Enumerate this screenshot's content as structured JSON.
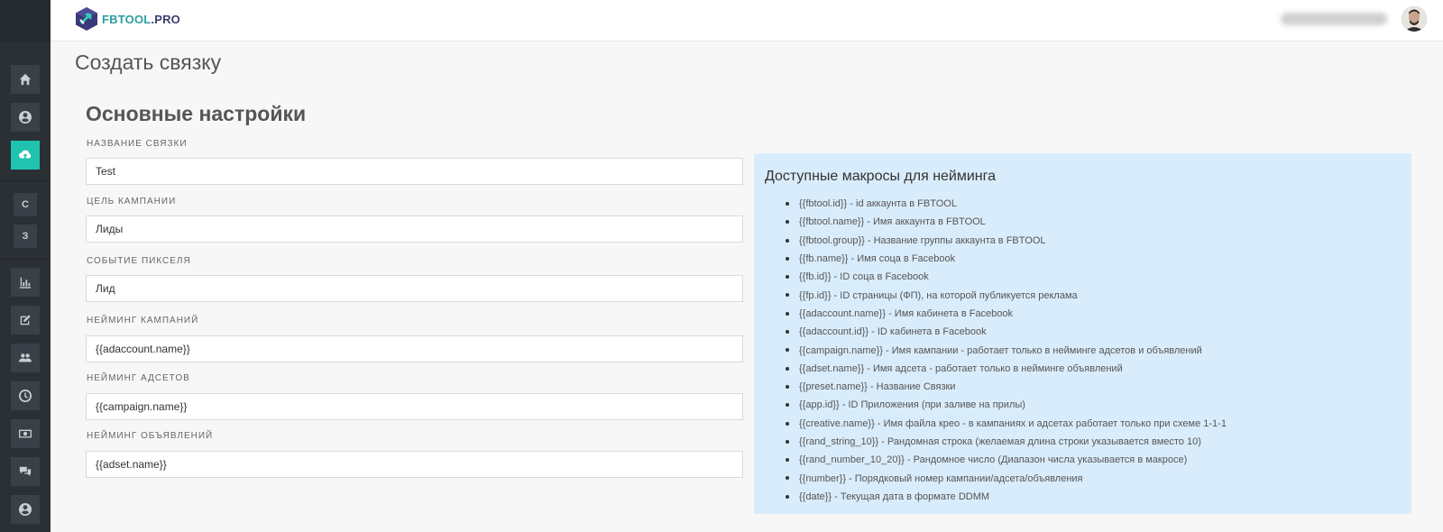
{
  "header": {
    "logo_part1": "FBTOOL",
    "logo_part2": ".PRO"
  },
  "page": {
    "title": "Создать связку",
    "section_title": "Основные настройки"
  },
  "sidebar": {
    "items": [
      {
        "icon": "home-icon"
      },
      {
        "icon": "user-circle-icon"
      },
      {
        "icon": "cloud-upload-icon",
        "active": true
      },
      {
        "letter": "С"
      },
      {
        "letter": "З"
      },
      {
        "icon": "bar-chart-icon"
      },
      {
        "icon": "edit-icon"
      },
      {
        "icon": "users-icon"
      },
      {
        "icon": "clock-icon"
      },
      {
        "icon": "money-icon"
      },
      {
        "icon": "comments-icon"
      },
      {
        "icon": "user-circle-icon"
      }
    ]
  },
  "form": {
    "fields": [
      {
        "label": "НАЗВАНИЕ СВЯЗКИ",
        "value": "Test"
      },
      {
        "label": "ЦЕЛЬ КАМПАНИИ",
        "value": "Лиды"
      },
      {
        "label": "СОБЫТИЕ ПИКСЕЛЯ",
        "value": "Лид"
      },
      {
        "label": "НЕЙМИНГ КАМПАНИЙ",
        "value": "{{adaccount.name}}"
      },
      {
        "label": "НЕЙМИНГ АДСЕТОВ",
        "value": "{{campaign.name}}"
      },
      {
        "label": "НЕЙМИНГ ОБЪЯВЛЕНИЙ",
        "value": "{{adset.name}}"
      }
    ]
  },
  "macros": {
    "title": "Доступные макросы для нейминга",
    "items": [
      {
        "code": "{{fbtool.id}}",
        "desc": " - id аккаунта в FBTOOL"
      },
      {
        "code": "{{fbtool.name}}",
        "desc": " - Имя аккаунта в FBTOOL"
      },
      {
        "code": "{{fbtool.group}}",
        "desc": " - Название группы аккаунта в FBTOOL"
      },
      {
        "code": "{{fb.name}}",
        "desc": " - Имя соца в Facebook"
      },
      {
        "code": "{{fb.id}}",
        "desc": " - ID соца в Facebook"
      },
      {
        "code": "{{fp.id}}",
        "desc": " - ID страницы (ФП), на которой публикуется реклама"
      },
      {
        "code": "{{adaccount.name}}",
        "desc": " - Имя кабинета в Facebook"
      },
      {
        "code": "{{adaccount.id}}",
        "desc": " - ID кабинета в Facebook"
      },
      {
        "code": "{{campaign.name}}",
        "desc": " - Имя кампании - работает только в нейминге адсетов и объявлений"
      },
      {
        "code": "{{adset.name}}",
        "desc": " - Имя адсета - работает только в нейминге объявлений"
      },
      {
        "code": "{{preset.name}}",
        "desc": " - Название Связки"
      },
      {
        "code": "{{app.id}}",
        "desc": " - ID Приложения (при заливе на прилы)"
      },
      {
        "code": "{{creative.name}}",
        "desc": " - Имя файла крео - в кампаниях и адсетах работает только при схеме 1-1-1"
      },
      {
        "code": "{{rand_string_10}}",
        "desc": " - Рандомная строка (желаемая длина строки указывается вместо 10)"
      },
      {
        "code": "{{rand_number_10_20}}",
        "desc": " - Рандомное число (Диапазон числа указывается в макросе)"
      },
      {
        "code": "{{number}}",
        "desc": " - Порядковый номер кампании/адсета/объявления"
      },
      {
        "code": "{{date}}",
        "desc": " - Текущая дата в формате DDMM"
      }
    ]
  }
}
